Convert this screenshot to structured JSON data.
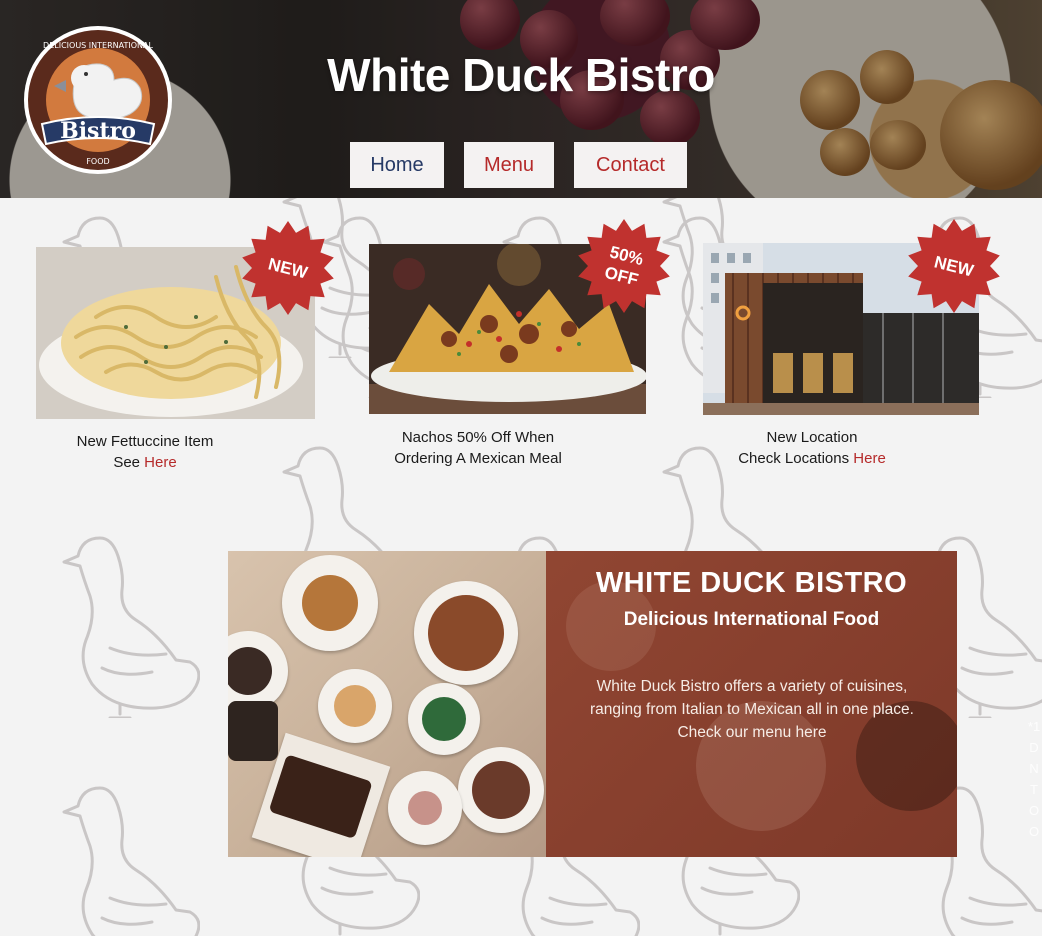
{
  "header": {
    "site_title": "White Duck Bistro",
    "logo": {
      "ring_text_top": "DELICIOUS INTERNATIONAL",
      "ring_text_bottom": "FOOD",
      "ribbon_text": "Bistro"
    },
    "nav": [
      {
        "label": "Home",
        "color": "#263a66"
      },
      {
        "label": "Menu",
        "color": "#b52a2a"
      },
      {
        "label": "Contact",
        "color": "#b52a2a"
      }
    ]
  },
  "promos": [
    {
      "badge": "NEW",
      "line1": "New Fettuccine Item",
      "line2_prefix": "See ",
      "link": "Here"
    },
    {
      "badge_line1": "50%",
      "badge_line2": "OFF",
      "line1": "Nachos 50% Off When",
      "line2": "Ordering A Mexican Meal"
    },
    {
      "badge": "NEW",
      "line1": "New Location",
      "line2_prefix": "Check Locations ",
      "link": "Here"
    }
  ],
  "banner": {
    "title": "WHITE DUCK BISTRO",
    "subtitle": "Delicious International Food",
    "body_line1": "White Duck Bistro offers a variety of cuisines,",
    "body_line2": "ranging from Italian to Mexican all in one place.",
    "body_line3": "Check our menu here"
  },
  "side_text": [
    "*1",
    "D",
    "N",
    "T",
    "O",
    "O"
  ],
  "colors": {
    "accent_red": "#b52a2a",
    "nav_blue": "#263a66",
    "badge_red": "#c0322f",
    "page_bg": "#f3f3f3"
  },
  "icons": {
    "logo": "duck-logo-icon",
    "badge": "starburst-badge-icon",
    "pattern": "duck-outline-icon"
  }
}
